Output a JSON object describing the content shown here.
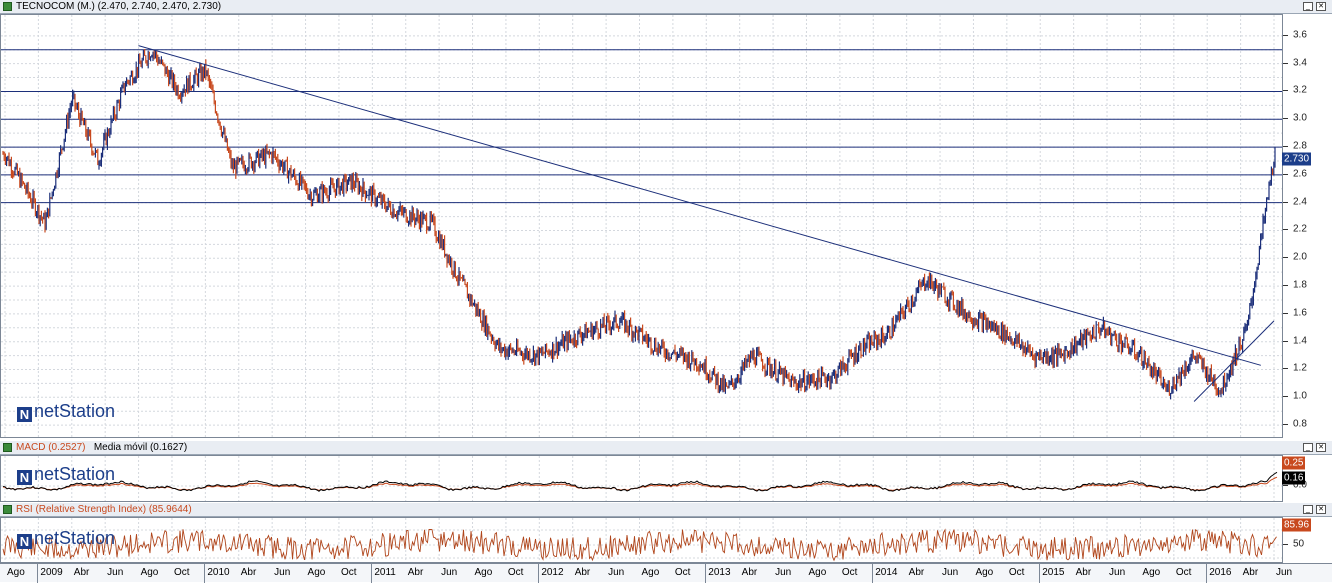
{
  "main": {
    "title": "TECNOCOM (M.) (2.470, 2.740, 2.470, 2.730)",
    "last_price": "2.730",
    "last_price_color": "#1c3e8a",
    "yticks": [
      "3.6",
      "3.4",
      "3.2",
      "3.0",
      "2.8",
      "2.6",
      "2.4",
      "2.2",
      "2.0",
      "1.8",
      "1.6",
      "1.4",
      "1.2",
      "1.0",
      "0.8"
    ],
    "logo_text": "netStation",
    "logo_mark": "N"
  },
  "macd": {
    "title_macd": "MACD (0.2527)",
    "title_ma": "Media móvil (0.1627)",
    "value_badge": "0.25",
    "signal_badge": "0.16",
    "yticks": [
      "0.0"
    ],
    "logo_text": "netStation",
    "logo_mark": "N"
  },
  "rsi": {
    "title": "RSI (Relative Strength Index) (85.9644)",
    "value_badge": "85.96",
    "yticks": [
      "50"
    ],
    "logo_text": "netStation",
    "logo_mark": "N"
  },
  "xaxis": {
    "labels": [
      "Ago",
      "2009",
      "Abr",
      "Jun",
      "Ago",
      "Oct",
      "2010",
      "Abr",
      "Jun",
      "Ago",
      "Oct",
      "2011",
      "Abr",
      "Jun",
      "Ago",
      "Oct",
      "2012",
      "Abr",
      "Jun",
      "Ago",
      "Oct",
      "2013",
      "Abr",
      "Jun",
      "Ago",
      "Oct",
      "2014",
      "Abr",
      "Jun",
      "Ago",
      "Oct",
      "2015",
      "Abr",
      "Jun",
      "Ago",
      "Oct",
      "2016",
      "Abr",
      "Jun"
    ]
  },
  "colors": {
    "up_bar": "#1c2f7a",
    "down_bar": "#c8491e",
    "trendline": "#1c2f7a",
    "rsi_line": "#b0461c",
    "macd_line": "#000000",
    "badge_red": "#c8491e"
  },
  "chart_data": {
    "type": "line",
    "title": "TECNOCOM (M.) (2.470, 2.740, 2.470, 2.730)",
    "ylim": [
      0.7,
      3.75
    ],
    "grid": true,
    "x": [
      "2008-08",
      "2008-11",
      "2009-01",
      "2009-03",
      "2009-05",
      "2009-07",
      "2009-09",
      "2009-11",
      "2010-01",
      "2010-04",
      "2010-07",
      "2010-10",
      "2011-01",
      "2011-04",
      "2011-06",
      "2011-09",
      "2011-12",
      "2012-03",
      "2012-06",
      "2012-09",
      "2012-12",
      "2013-02",
      "2013-04",
      "2013-07",
      "2013-10",
      "2013-12",
      "2014-02",
      "2014-05",
      "2014-08",
      "2014-11",
      "2015-01",
      "2015-03",
      "2015-06",
      "2015-09",
      "2015-11",
      "2016-01",
      "2016-03",
      "2016-05",
      "2016-07"
    ],
    "values": [
      2.75,
      2.25,
      3.15,
      2.7,
      3.25,
      3.5,
      3.2,
      3.35,
      2.65,
      2.75,
      2.45,
      2.55,
      2.35,
      2.25,
      1.85,
      1.35,
      1.3,
      1.45,
      1.55,
      1.35,
      1.25,
      1.05,
      1.3,
      1.1,
      1.15,
      1.35,
      1.45,
      1.85,
      1.6,
      1.45,
      1.3,
      1.3,
      1.5,
      1.3,
      1.05,
      1.3,
      1.05,
      1.5,
      2.73
    ],
    "horizontal_levels": [
      3.5,
      3.2,
      3.0,
      2.8,
      2.6,
      2.4
    ],
    "trendlines": [
      {
        "from": [
          "2009-06",
          3.53
        ],
        "to": [
          "2016-06",
          1.23
        ]
      },
      {
        "from": [
          "2016-01",
          0.97
        ],
        "to": [
          "2016-07",
          1.55
        ]
      }
    ]
  }
}
